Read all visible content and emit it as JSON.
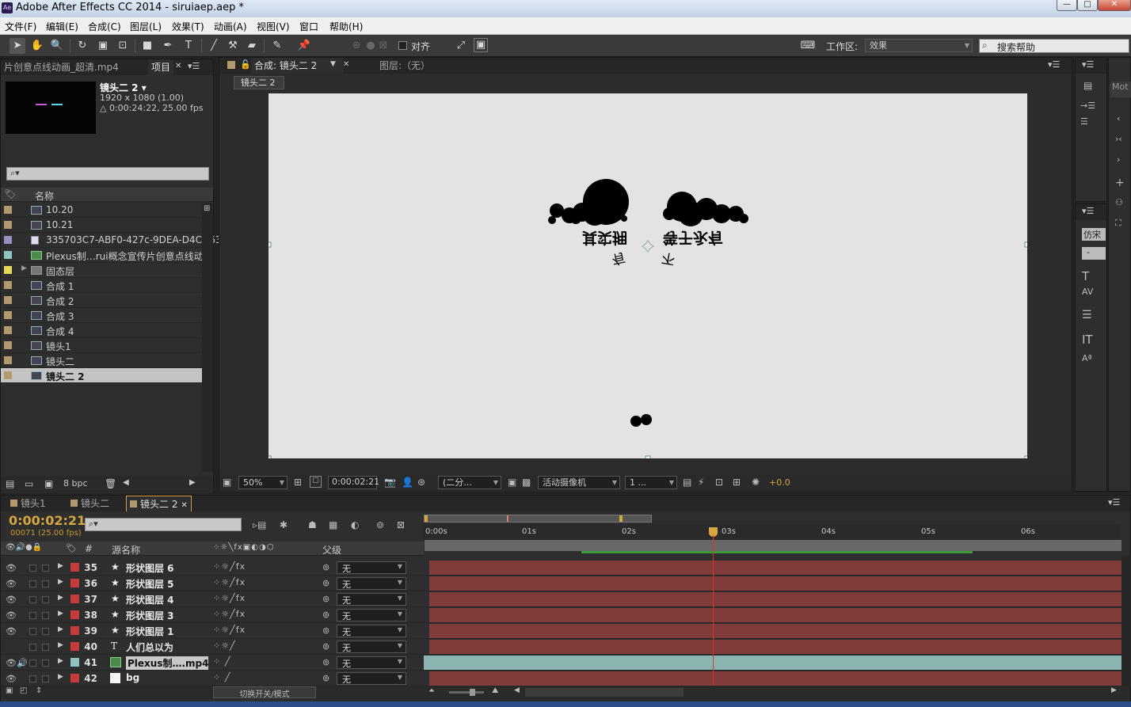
{
  "window": {
    "title": "Adobe After Effects CC 2014 - siruiaep.aep *",
    "logo": "Ae"
  },
  "menu": [
    "文件(F)",
    "编辑(E)",
    "合成(C)",
    "图层(L)",
    "效果(T)",
    "动画(A)",
    "视图(V)",
    "窗口",
    "帮助(H)"
  ],
  "toolbar": {
    "snap_label": "对齐",
    "workspace_label": "工作区:",
    "workspace_value": "效果",
    "search_placeholder": "搜索帮助"
  },
  "project": {
    "other_tab": "片创意点线动画_超清.mp4",
    "tab": "项目",
    "selected_name": "镜头二 2 ▾",
    "selected_size": "1920 x 1080 (1.00)",
    "selected_duration": "△ 0:00:24:22, 25.00 fps",
    "search": "⌕▾",
    "col_name": "名称",
    "bpc": "8 bpc",
    "items": [
      {
        "name": "10.20",
        "label": "#b29a6e"
      },
      {
        "name": "10.21",
        "label": "#b29a6e"
      },
      {
        "name": "335703C7-ABF0-427c-9DEA-D4CD635D",
        "label": "#9a8fc4"
      },
      {
        "name": "Plexus制…rui概念宣传片创意点线动",
        "label": "#8fc4c0"
      },
      {
        "name": "固态层",
        "label": "#e6d65a"
      },
      {
        "name": "合成 1",
        "label": "#b29a6e"
      },
      {
        "name": "合成 2",
        "label": "#b29a6e"
      },
      {
        "name": "合成 3",
        "label": "#b29a6e"
      },
      {
        "name": "合成 4",
        "label": "#b29a6e"
      },
      {
        "name": "镜头1",
        "label": "#b29a6e"
      },
      {
        "name": "镜头二",
        "label": "#b29a6e"
      },
      {
        "name": "镜头二 2",
        "label": "#b29a6e"
      }
    ]
  },
  "composition": {
    "tab": "合成: 镜头二 2",
    "layer_tab": "图层:（无）",
    "breadcrumb": "镜头二 2",
    "zoom": "50%",
    "timecode": "0:00:02:21",
    "resolution": "(二分...",
    "camera": "活动摄像机",
    "views": "1 ...",
    "exposure": "+0.0",
    "canvas_text_left": "其实拥",
    "canvas_text_right": "等于永有",
    "canvas_text_sub1": "有",
    "canvas_text_sub2": "不"
  },
  "timeline": {
    "tabs": [
      "镜头1",
      "镜头二",
      "镜头二 2"
    ],
    "timecode": "0:00:02:21",
    "frame_info": "00071 (25.00 fps)",
    "col_source": "源名称",
    "col_parent": "父级",
    "col_num": "#",
    "ruler": [
      "0:00s",
      "01s",
      "02s",
      "03s",
      "04s",
      "05s",
      "06s"
    ],
    "layers": [
      {
        "num": "35",
        "name": "形状图层 6",
        "parent": "无",
        "color": "#c43c3c",
        "type": "shape"
      },
      {
        "num": "36",
        "name": "形状图层 5",
        "parent": "无",
        "color": "#c43c3c",
        "type": "shape"
      },
      {
        "num": "37",
        "name": "形状图层 4",
        "parent": "无",
        "color": "#c43c3c",
        "type": "shape"
      },
      {
        "num": "38",
        "name": "形状图层 3",
        "parent": "无",
        "color": "#c43c3c",
        "type": "shape"
      },
      {
        "num": "39",
        "name": "形状图层 1",
        "parent": "无",
        "color": "#c43c3c",
        "type": "shape"
      },
      {
        "num": "40",
        "name": "人们总以为",
        "parent": "无",
        "color": "#c43c3c",
        "type": "text"
      },
      {
        "num": "41",
        "name": "Plexus制….mp4",
        "parent": "无",
        "color": "#8fc4c0",
        "type": "footage"
      },
      {
        "num": "42",
        "name": "bg",
        "parent": "无",
        "color": "#c43c3c",
        "type": "solid"
      }
    ],
    "toggle_label": "切换开关/模式"
  },
  "right_panel": {
    "panel_label": "Mot",
    "para_label": "仿宋",
    "dash": "-"
  }
}
